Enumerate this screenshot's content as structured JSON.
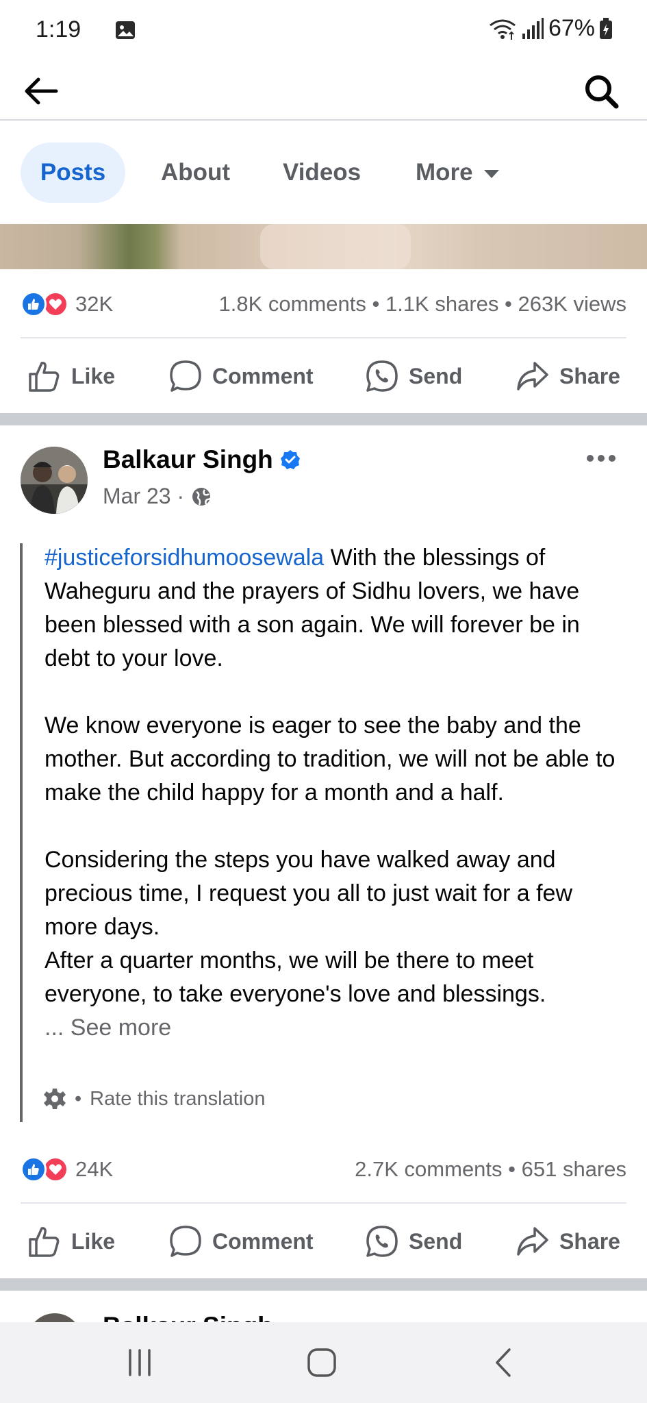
{
  "status_bar": {
    "time": "1:19",
    "battery": "67%",
    "icons": [
      "photo-icon",
      "wifi-icon",
      "signal-icon",
      "battery-icon"
    ]
  },
  "top_bar": {
    "back_icon": "arrow-left-icon",
    "search_icon": "search-icon"
  },
  "tabs": [
    {
      "label": "Posts",
      "active": true
    },
    {
      "label": "About",
      "active": false
    },
    {
      "label": "Videos",
      "active": false
    },
    {
      "label": "More",
      "active": false
    }
  ],
  "post1": {
    "reaction_count": "32K",
    "stats": "1.8K comments • 1.1K shares • 263K views"
  },
  "actions": {
    "like": "Like",
    "comment": "Comment",
    "send": "Send",
    "share": "Share"
  },
  "post2": {
    "author": "Balkaur Singh",
    "date": "Mar 23 ·",
    "hashtag": "#justiceforsidhumoosewala",
    "para1": " With the blessings of Waheguru and the prayers of Sidhu lovers, we have been blessed with a son again. We will forever be in debt to your love.",
    "para2": "We know everyone is eager to see the baby and the mother. But according to tradition, we will not be able to make the child happy for a month and a half.",
    "para3": "Considering the steps you have walked away and precious time, I request you all to just wait for a few more days.",
    "para4": "After a quarter months, we will be there to meet everyone, to take everyone's love and blessings.",
    "see_more": "... See more",
    "rate_translation": "Rate this translation",
    "reaction_count": "24K",
    "stats": "2.7K comments • 651 shares"
  },
  "next_post": {
    "author": "Balkaur Singh"
  },
  "colors": {
    "accent": "#1665cf",
    "tab_active_bg": "#e7f1fd",
    "like_blue": "#1b74e4",
    "love_red": "#f33e58",
    "secondary_text": "#65676b"
  }
}
